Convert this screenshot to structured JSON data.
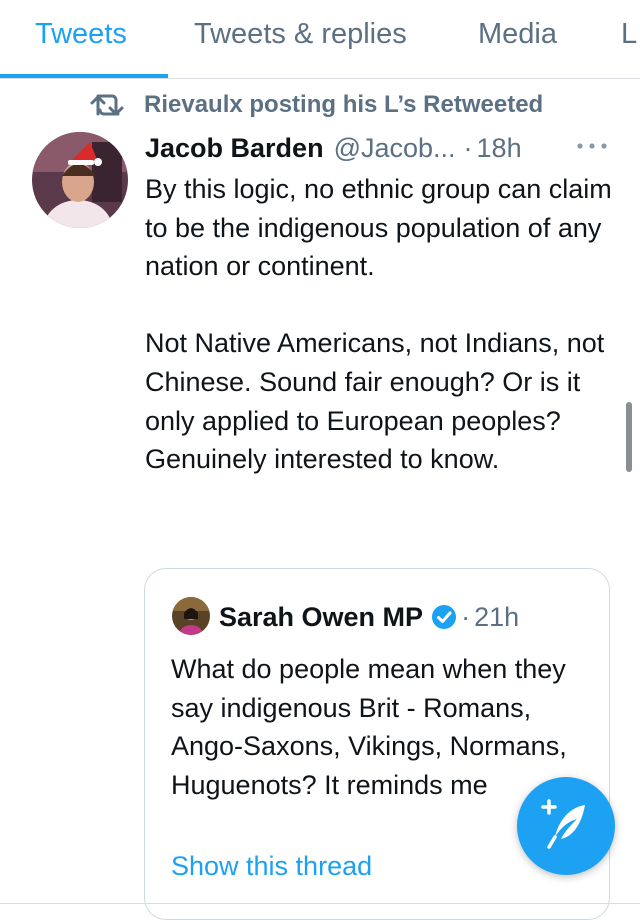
{
  "tabs": [
    {
      "label": "Tweets",
      "active": true
    },
    {
      "label": "Tweets & replies",
      "active": false
    },
    {
      "label": "Media",
      "active": false
    },
    {
      "label": "L",
      "active": false
    }
  ],
  "retweet_context": {
    "text": "Rievaulx posting his L’s Retweeted",
    "icon": "retweet-icon"
  },
  "tweet": {
    "author_name": "Jacob Barden",
    "author_handle": "@Jacob...",
    "separator": "·",
    "time": "18h",
    "body": [
      "By this logic, no ethnic group can claim to be the indigenous population of any nation or continent.",
      "Not Native Americans, not Indians, not Chinese. Sound fair enough? Or is it only applied to European peoples? Genuinely interested to know."
    ]
  },
  "quote": {
    "author_name": "Sarah Owen MP",
    "verified": true,
    "separator": "·",
    "time": "21h",
    "body": "What do people mean when they say indigenous Brit - Romans, Ango-Saxons, Vikings, Normans, Huguenots? It reminds me",
    "show_thread_label": "Show this thread"
  },
  "colors": {
    "accent": "#1da1f2",
    "secondary_text": "#5b7083",
    "primary_text": "#0f1419",
    "border": "#cfd9de"
  },
  "icons": [
    "retweet-icon",
    "more-icon",
    "verified-icon",
    "compose-tweet-icon"
  ]
}
